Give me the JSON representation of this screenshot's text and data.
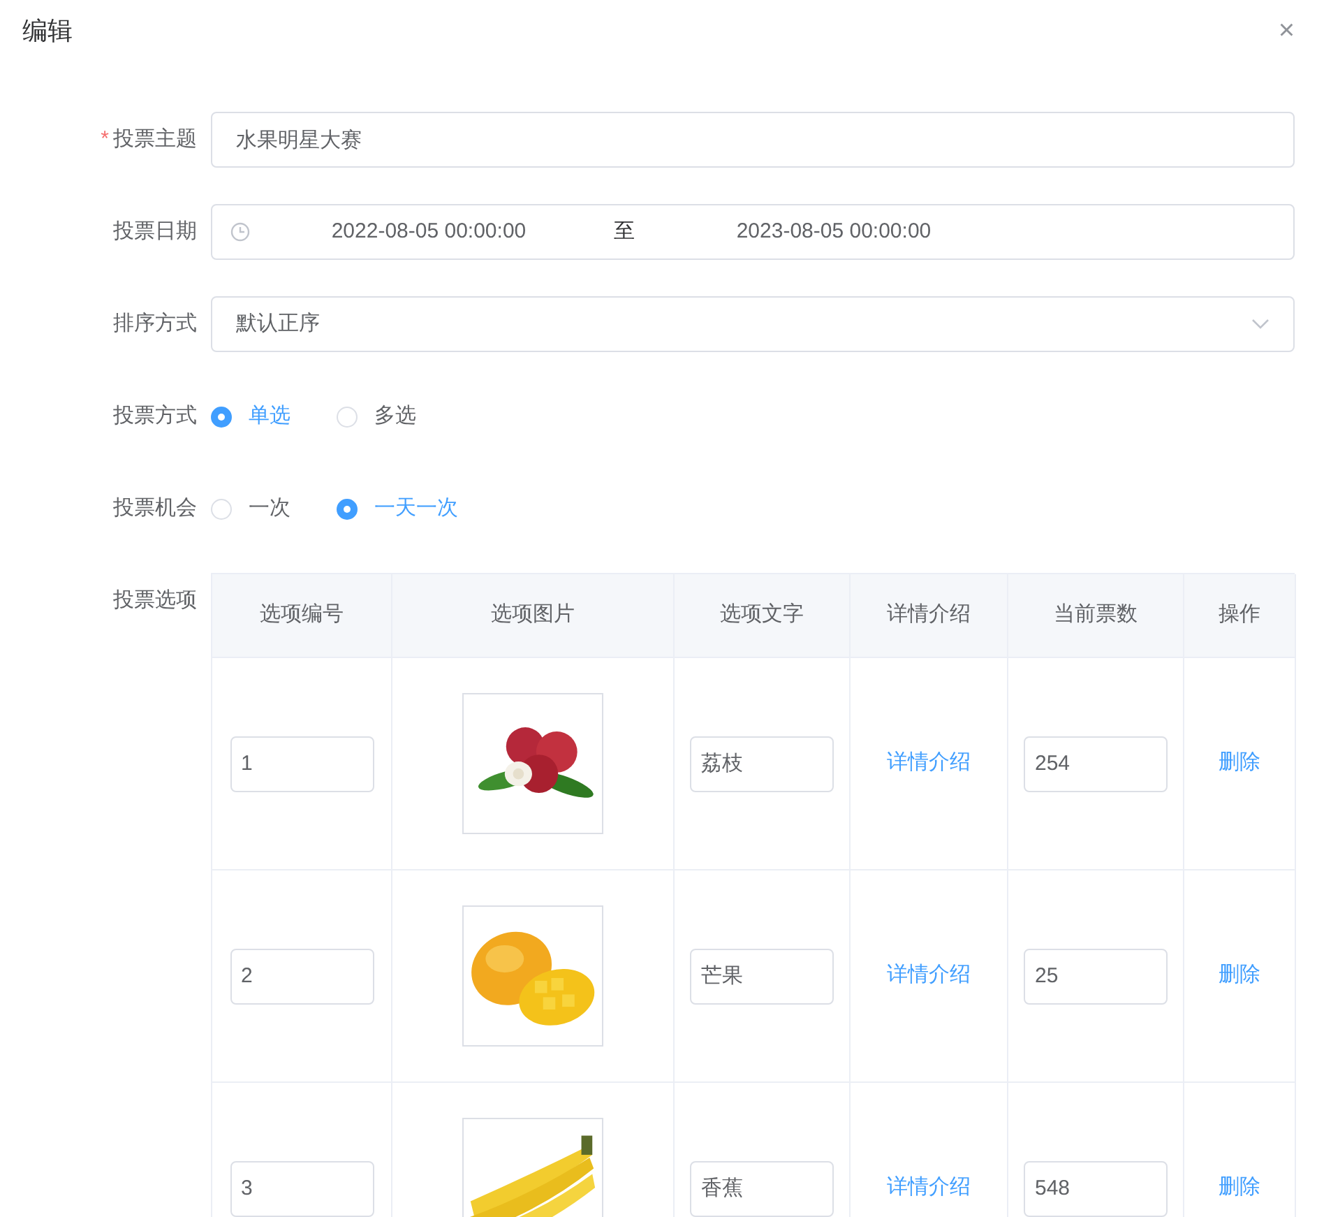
{
  "dialog": {
    "title": "编辑",
    "close": "×"
  },
  "form": {
    "subject": {
      "label": "投票主题",
      "required_mark": "*",
      "value": "水果明星大赛"
    },
    "date": {
      "label": "投票日期",
      "start": "2022-08-05 00:00:00",
      "separator": "至",
      "end": "2023-08-05 00:00:00"
    },
    "sort": {
      "label": "排序方式",
      "value": "默认正序"
    },
    "vote_mode": {
      "label": "投票方式",
      "options": [
        {
          "label": "单选",
          "selected": true
        },
        {
          "label": "多选",
          "selected": false
        }
      ]
    },
    "vote_chance": {
      "label": "投票机会",
      "options": [
        {
          "label": "一次",
          "selected": false
        },
        {
          "label": "一天一次",
          "selected": true
        }
      ]
    },
    "options": {
      "label": "投票选项",
      "table": {
        "columns": [
          "选项编号",
          "选项图片",
          "选项文字",
          "详情介绍",
          "当前票数",
          "操作"
        ],
        "rows": [
          {
            "number": "1",
            "text": "荔枝",
            "detail": "详情介绍",
            "votes": "254",
            "action": "删除"
          },
          {
            "number": "2",
            "text": "芒果",
            "detail": "详情介绍",
            "votes": "25",
            "action": "删除"
          },
          {
            "number": "3",
            "text": "香蕉",
            "detail": "详情介绍",
            "votes": "548",
            "action": "删除"
          }
        ]
      }
    }
  }
}
